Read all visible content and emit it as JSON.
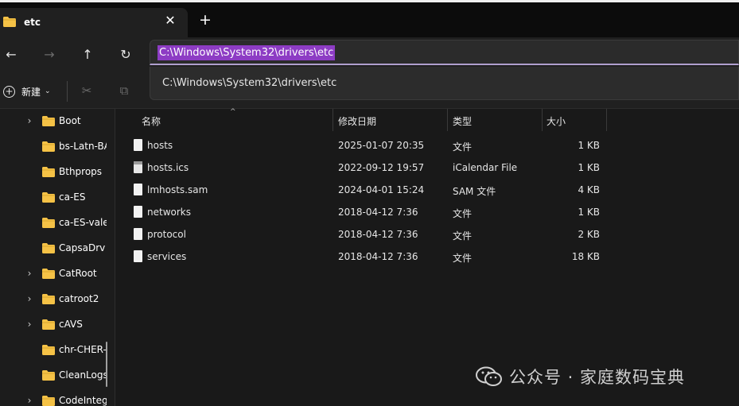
{
  "tab": {
    "title": "etc",
    "close": "✕",
    "new_tab": "+"
  },
  "nav": {
    "back": "←",
    "forward": "→",
    "up": "↑",
    "refresh": "↻",
    "address_value": "C:\\Windows\\System32\\drivers\\etc"
  },
  "suggestion": {
    "item": "C:\\Windows\\System32\\drivers\\etc"
  },
  "command_bar": {
    "new_label": "新建",
    "new_caret": "⌄",
    "cut_icon": "✂",
    "copy_icon": "⧉"
  },
  "sidebar": {
    "items": [
      {
        "label": "Boot",
        "expandable": true
      },
      {
        "label": "bs-Latn-BA",
        "expandable": false
      },
      {
        "label": "Bthprops",
        "expandable": false
      },
      {
        "label": "ca-ES",
        "expandable": false
      },
      {
        "label": "ca-ES-valencia",
        "expandable": false
      },
      {
        "label": "CapsaDrv",
        "expandable": false
      },
      {
        "label": "CatRoot",
        "expandable": true
      },
      {
        "label": "catroot2",
        "expandable": true
      },
      {
        "label": "cAVS",
        "expandable": true
      },
      {
        "label": "chr-CHER-US",
        "expandable": false
      },
      {
        "label": "CleanLogs",
        "expandable": false
      },
      {
        "label": "CodeIntegrity",
        "expandable": true
      }
    ],
    "chevron": "›"
  },
  "file_list": {
    "headers": {
      "name": "名称",
      "modified": "修改日期",
      "type": "类型",
      "size": "大小"
    },
    "sort_indicator": "^",
    "rows": [
      {
        "name": "hosts",
        "modified": "2025-01-07 20:35",
        "type": "文件",
        "size": "1 KB",
        "icon": "file-icon"
      },
      {
        "name": "hosts.ics",
        "modified": "2022-09-12 19:57",
        "type": "iCalendar File",
        "size": "1 KB",
        "icon": "calendar-file-icon"
      },
      {
        "name": "lmhosts.sam",
        "modified": "2024-04-01 15:24",
        "type": "SAM 文件",
        "size": "4 KB",
        "icon": "file-icon"
      },
      {
        "name": "networks",
        "modified": "2018-04-12 7:36",
        "type": "文件",
        "size": "1 KB",
        "icon": "file-icon"
      },
      {
        "name": "protocol",
        "modified": "2018-04-12 7:36",
        "type": "文件",
        "size": "2 KB",
        "icon": "file-icon"
      },
      {
        "name": "services",
        "modified": "2018-04-12 7:36",
        "type": "文件",
        "size": "18 KB",
        "icon": "file-icon"
      }
    ]
  },
  "watermark": {
    "text": "公众号 · 家庭数码宝典",
    "icon": "wechat-icon"
  },
  "colors": {
    "folder": "#f5c246",
    "selection": "#8d3cc4",
    "address_underline": "#b09fce"
  }
}
